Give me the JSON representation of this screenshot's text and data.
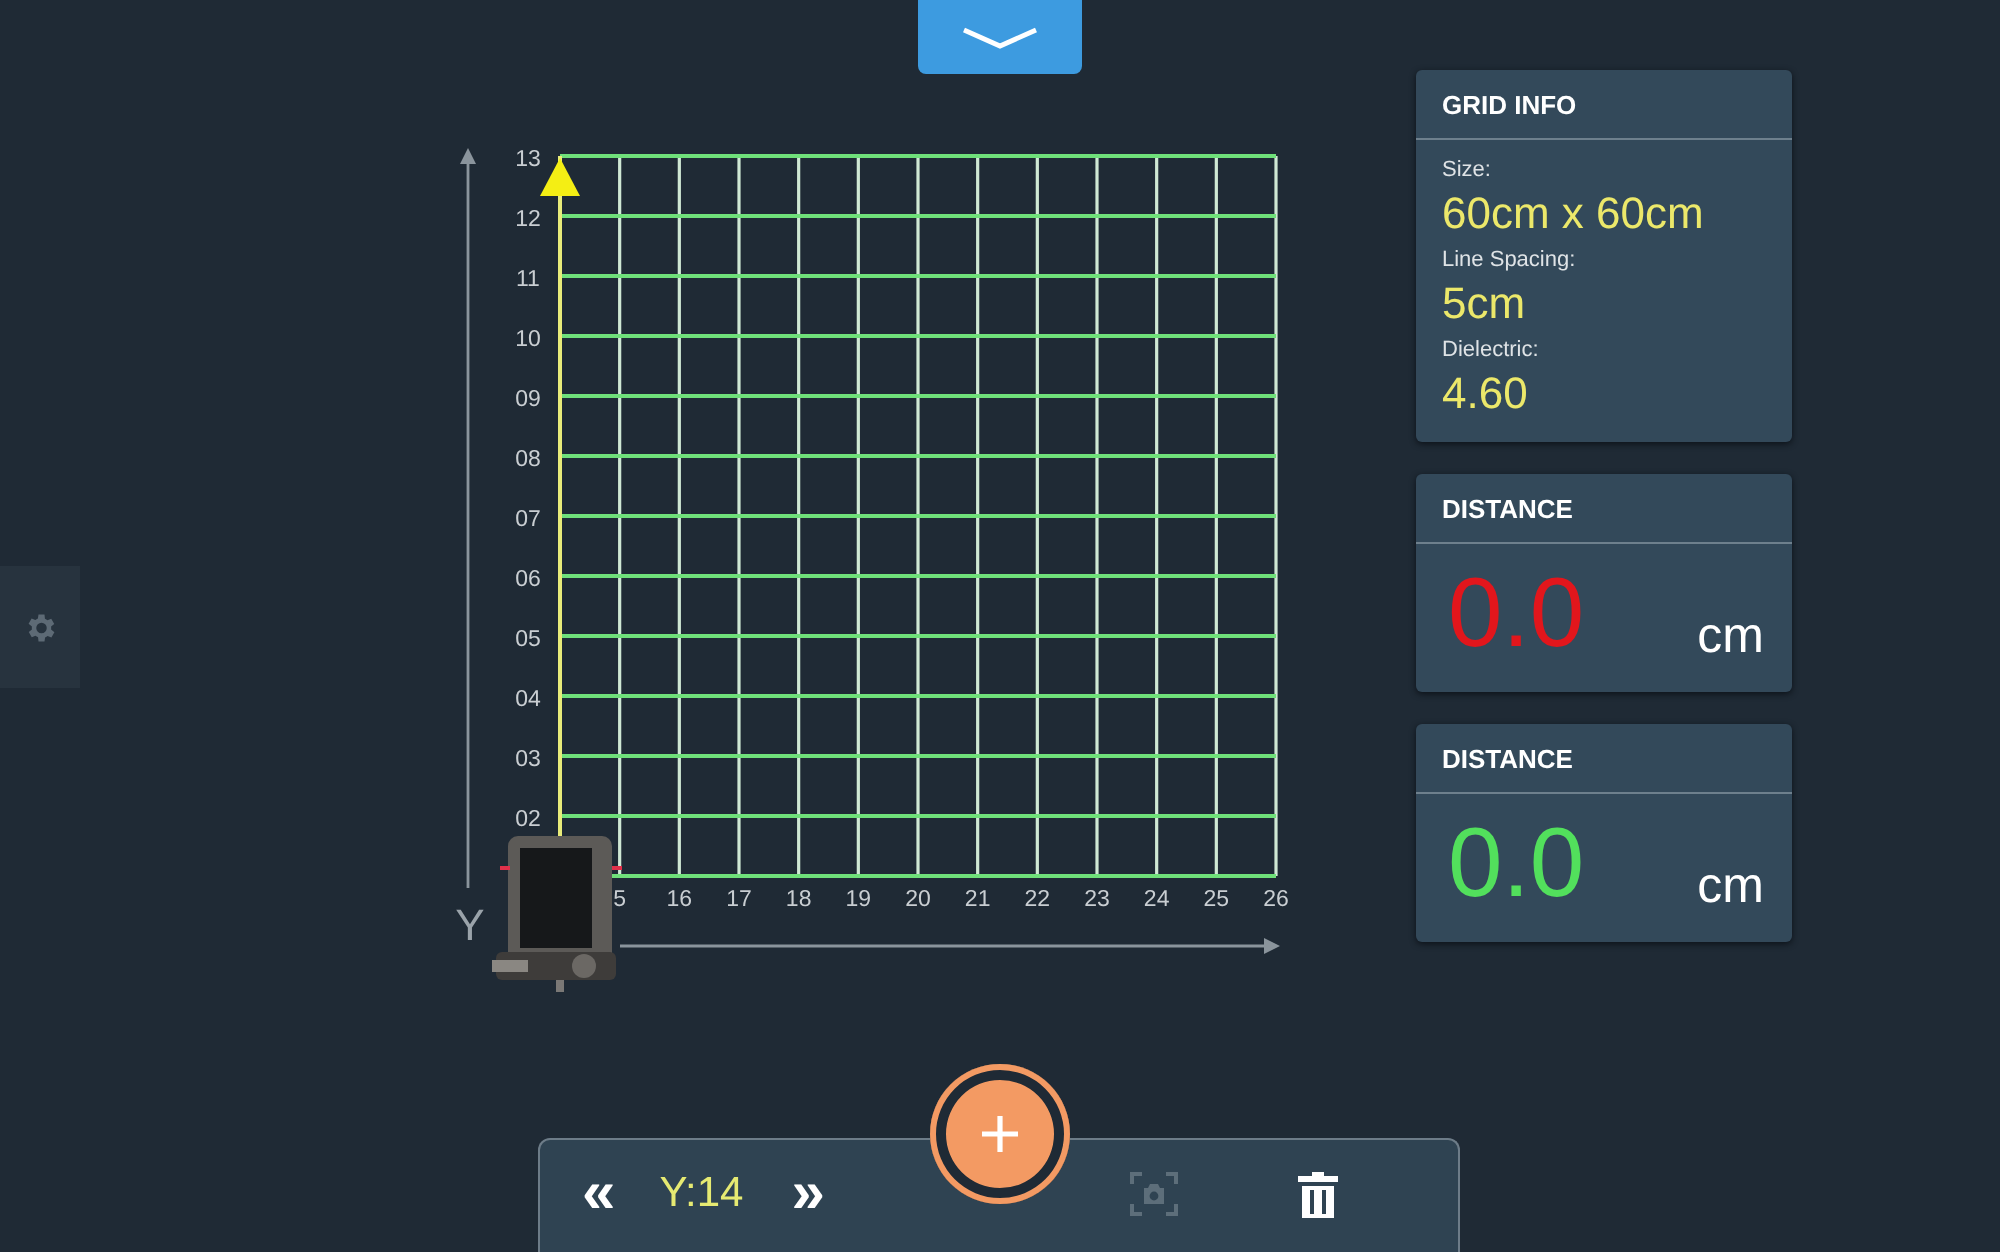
{
  "grid": {
    "y_labels": [
      "13",
      "12",
      "11",
      "10",
      "09",
      "08",
      "07",
      "06",
      "05",
      "04",
      "03",
      "02"
    ],
    "x_labels": [
      "5",
      "16",
      "17",
      "18",
      "19",
      "20",
      "21",
      "22",
      "23",
      "24",
      "25",
      "26"
    ],
    "axis_label": "Y"
  },
  "grid_info": {
    "title": "GRID INFO",
    "fields": [
      {
        "label": "Size:",
        "value": "60cm x 60cm"
      },
      {
        "label": "Line Spacing:",
        "value": "5cm"
      },
      {
        "label": "Dielectric:",
        "value": "4.60"
      }
    ]
  },
  "distance_panels": [
    {
      "title": "DISTANCE",
      "value": "0.0",
      "unit": "cm",
      "color": "#e2161c"
    },
    {
      "title": "DISTANCE",
      "value": "0.0",
      "unit": "cm",
      "color": "#52e05c"
    }
  ],
  "toolbar": {
    "prev": "«",
    "position": "Y:14",
    "next": "»",
    "capture": {
      "disabled": true
    }
  }
}
